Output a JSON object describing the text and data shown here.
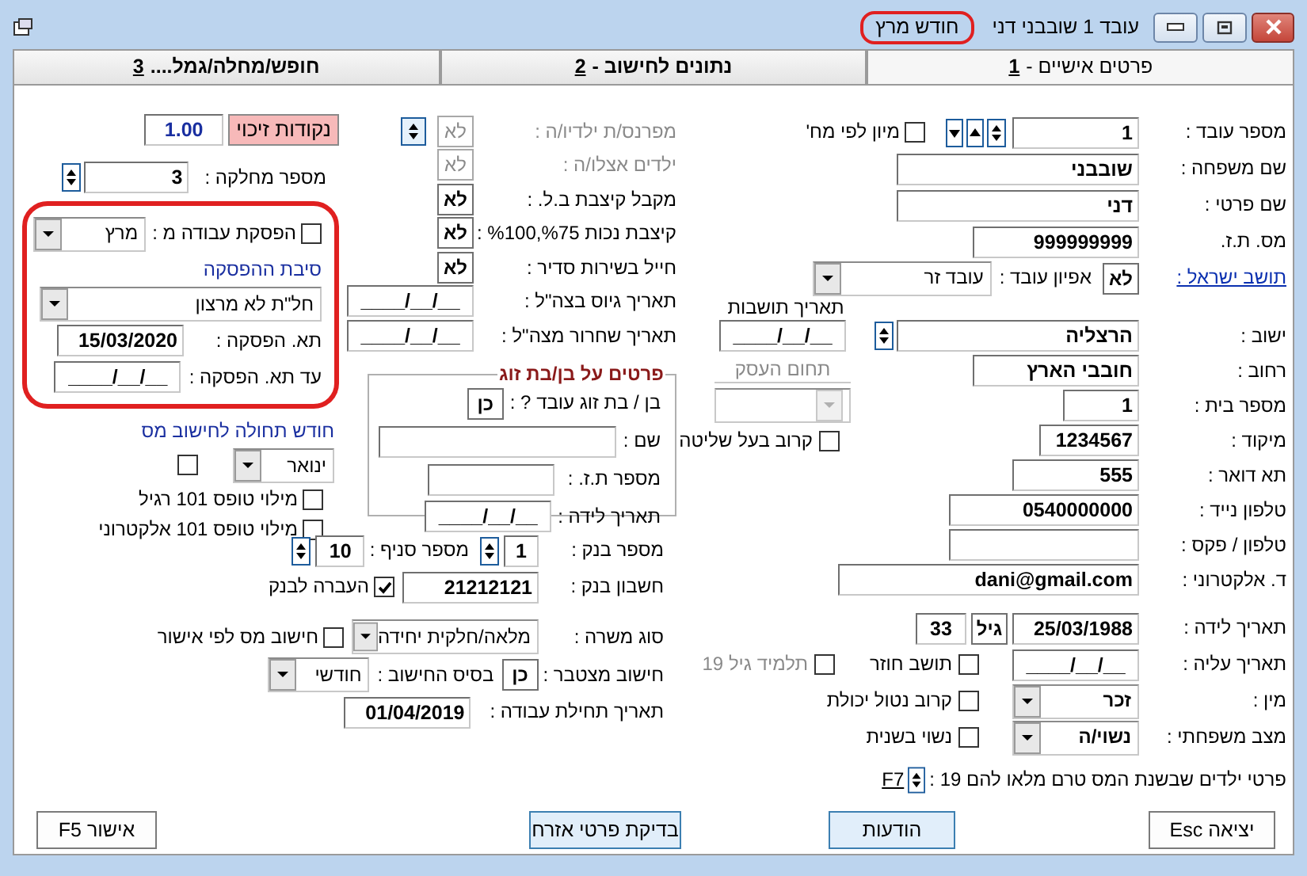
{
  "window": {
    "title": "עובד 1 שובבני דני",
    "month": "חודש מרץ"
  },
  "tabs": [
    {
      "label": "פרטים אישיים -",
      "key": "1",
      "selected": true
    },
    {
      "label": "נתונים לחישוב -",
      "key": "2",
      "selected": false
    },
    {
      "label": "חופש/מחלה/גמל....",
      "key": "3",
      "selected": false
    }
  ],
  "personal": {
    "employee_number": {
      "label": "מספר עובד :",
      "value": "1"
    },
    "sort_by_department": {
      "label": "מיון לפי מח'",
      "checked": false
    },
    "last_name": {
      "label": "שם משפחה :",
      "value": "שובבני"
    },
    "first_name": {
      "label": "שם פרטי :",
      "value": "דני"
    },
    "id_number": {
      "label": "מס. ת.ז.",
      "value": "999999999"
    },
    "israeli_resident": {
      "label": "תושב ישראל :",
      "value": "לא"
    },
    "employee_type": {
      "label": "אפיון עובד :",
      "value": "עובד זר"
    },
    "residence_date": {
      "label": "תאריך תושבות",
      "value": "__/__/____"
    },
    "city": {
      "label": "ישוב :",
      "value": "הרצליה"
    },
    "street": {
      "label": "רחוב :",
      "value": "חובבי הארץ"
    },
    "business_field": {
      "label": "תחום העסק",
      "disabled": true
    },
    "house_number": {
      "label": "מספר בית :",
      "value": "1"
    },
    "zip": {
      "label": "מיקוד :",
      "value": "1234567"
    },
    "controlling_relative": {
      "label": "קרוב בעל שליטה",
      "checked": false
    },
    "po_box": {
      "label": "תא דואר :",
      "value": "555"
    },
    "mobile": {
      "label": "טלפון נייד :",
      "value": "0540000000"
    },
    "phone_fax": {
      "label": "טלפון / פקס :"
    },
    "email": {
      "label": "ד. אלקטרוני :",
      "value": "dani@gmail.com"
    },
    "birth_date": {
      "label": "תאריך לידה :",
      "value": "25/03/1988"
    },
    "age": {
      "label": "גיל",
      "value": "33"
    },
    "immigration_date": {
      "label": "תאריך עליה :",
      "value": "__/__/____"
    },
    "returning_resident": {
      "label": "תושב חוזר",
      "checked": false
    },
    "student_19": {
      "label": "תלמיד גיל 19",
      "checked": false,
      "disabled": true
    },
    "gender": {
      "label": "מין :",
      "value": "זכר"
    },
    "disabled_relative": {
      "label": "קרוב נטול יכולת",
      "checked": false
    },
    "marital_status": {
      "label": "מצב משפחתי :",
      "value": "נשוי/ה"
    },
    "remarried": {
      "label": "נשוי בשנית",
      "checked": false
    },
    "children": {
      "label": "פרטי ילדים שבשנת המס טרם מלאו להם 19 :",
      "key": "F7"
    }
  },
  "flags": [
    {
      "label": "מפרנס/ת ילדיו/ה :",
      "value": "לא",
      "disabled": true
    },
    {
      "label": "ילדים אצלו/ה :",
      "value": "לא",
      "disabled": true
    },
    {
      "label": "מקבל קיצבת ב.ל. :",
      "value": "לא",
      "disabled": false
    },
    {
      "label": "קיצבת נכות %75,%100 :",
      "value": "לא",
      "disabled": false
    },
    {
      "label": "חייל בשירות סדיר :",
      "value": "לא",
      "disabled": false
    }
  ],
  "army": {
    "enlistment_date": {
      "label": "תאריך גיוס בצה\"ל :",
      "value": "__/__/____"
    },
    "discharge_date": {
      "label": "תאריך שחרור מצה\"ל :",
      "value": "__/__/____"
    }
  },
  "spouse": {
    "title": "פרטים על בן/בת זוג",
    "works": {
      "label": "בן / בת זוג עובד ? :",
      "value": "כן"
    },
    "name": {
      "label": "שם :"
    },
    "id_number": {
      "label": "מספר ת.ז. :"
    },
    "birth_date": {
      "label": "תאריך לידה :",
      "value": "__/__/____"
    }
  },
  "left": {
    "credit_points": {
      "label": "נקודות זיכוי",
      "value": "1.00"
    },
    "department": {
      "label": "מספר מחלקה :",
      "value": "3"
    },
    "stop_work": {
      "label": "הפסקת עבודה מ :",
      "checked": false,
      "month": "מרץ"
    },
    "stop_reason": {
      "label": "סיבת ההפסקה",
      "value": "חל\"ת לא מרצון"
    },
    "stop_date": {
      "label": "תא. הפסקה :",
      "value": "15/03/2020"
    },
    "stop_until": {
      "label": "עד תא. הפסקה :",
      "value": "__/__/____"
    },
    "tax_month": {
      "label": "חודש תחולה לחישוב מס",
      "value": "ינואר",
      "checked": false
    },
    "form101_regular": {
      "label": "מילוי טופס 101 רגיל",
      "checked": false
    },
    "form101_electronic": {
      "label": "מילוי טופס 101 אלקטרוני",
      "checked": false
    }
  },
  "bank": {
    "bank_number": {
      "label": "מספר בנק :",
      "value": "1"
    },
    "branch": {
      "label": "מספר סניף :",
      "value": "10"
    },
    "account": {
      "label": "חשבון בנק :",
      "value": "21212121"
    },
    "transfer": {
      "label": "העברה לבנק",
      "checked": true
    },
    "job_type": {
      "label": "סוג משרה :",
      "value": "מלאה/חלקית יחידה"
    },
    "tax_by_approval": {
      "label": "חישוב מס לפי אישור",
      "checked": false
    },
    "cumulative": {
      "label": "חישוב מצטבר :",
      "value": "כן"
    },
    "calc_basis": {
      "label": "בסיס החישוב :",
      "value": "חודשי"
    },
    "start_date": {
      "label": "תאריך תחילת עבודה :",
      "value": "01/04/2019"
    }
  },
  "buttons": [
    {
      "label": "יציאה Esc",
      "highlighted": false
    },
    {
      "label": "הודעות",
      "highlighted": true
    },
    {
      "label": "בדיקת פרטי אזרח",
      "highlighted": true
    },
    {
      "label": "אישור F5",
      "highlighted": false
    }
  ]
}
